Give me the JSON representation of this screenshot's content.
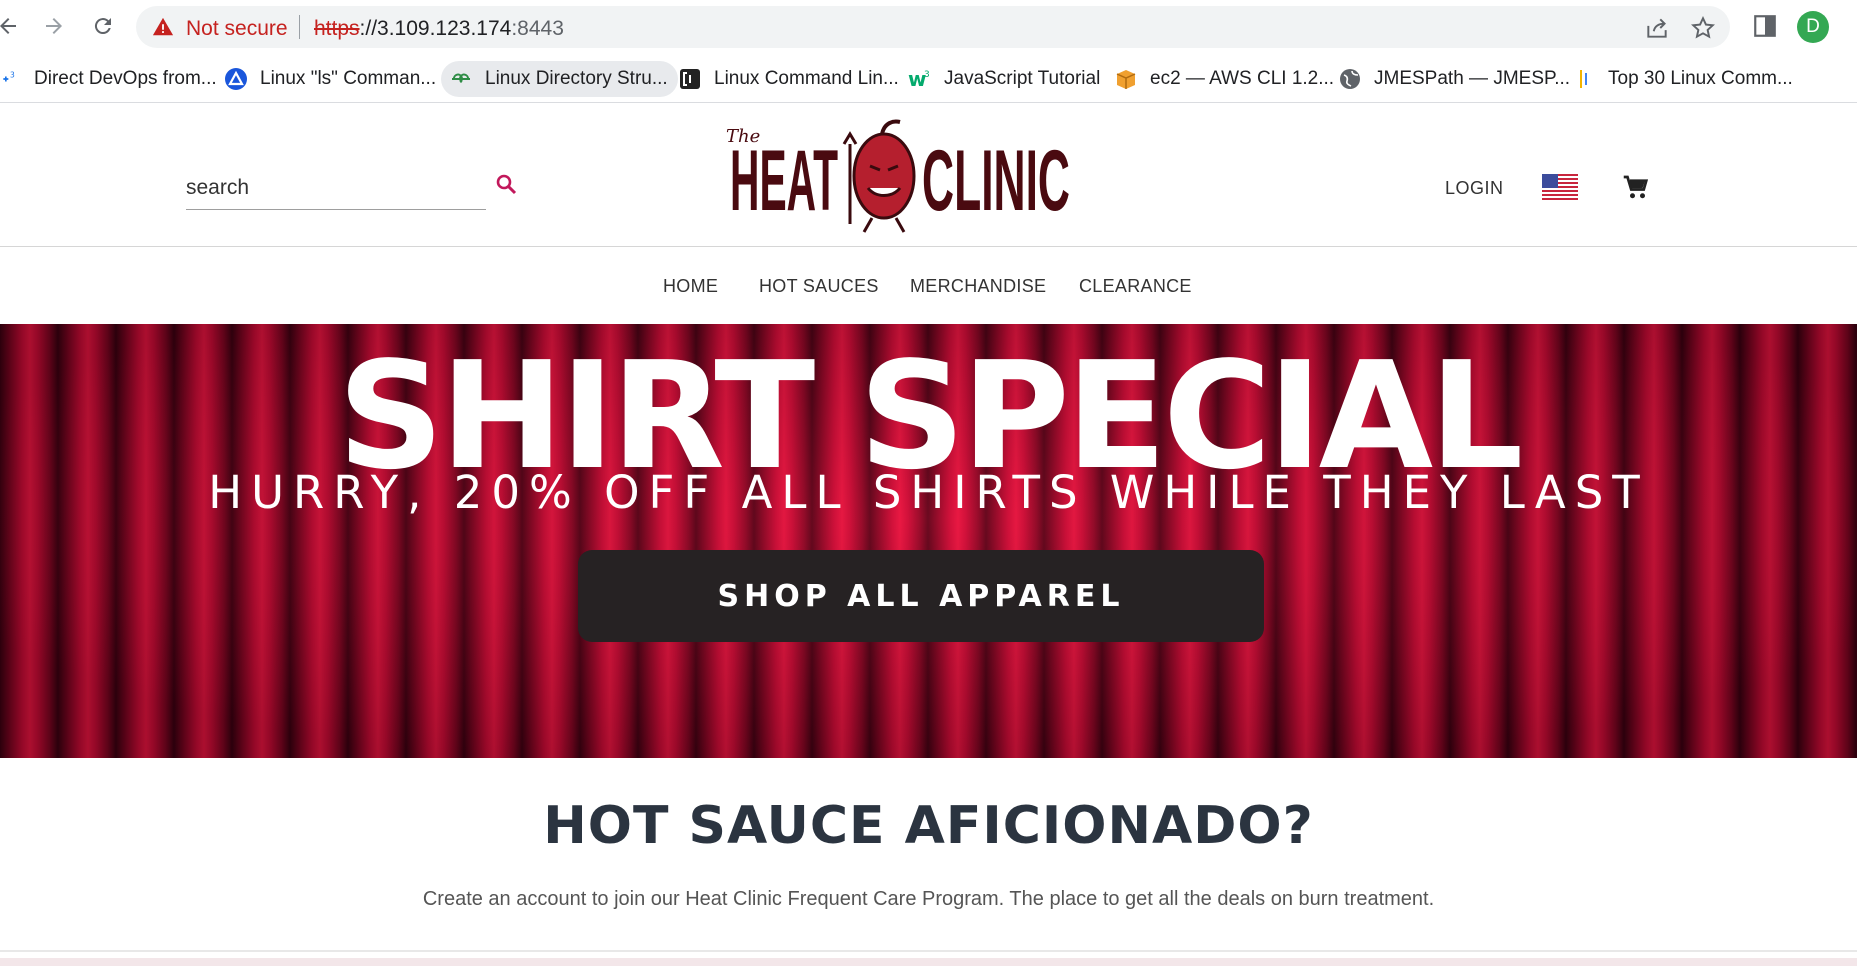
{
  "browser": {
    "security_label": "Not secure",
    "url_scheme": "https",
    "url_rest": "://3.109.123.174",
    "url_port": ":8443",
    "avatar_letter": "D",
    "bookmarks": [
      {
        "label": "Direct DevOps from...",
        "icon": "devops-icon"
      },
      {
        "label": "Linux \"ls\" Comman...",
        "icon": "triangle-logo-icon"
      },
      {
        "label": "Linux Directory Stru...",
        "icon": "geeksforgeeks-icon"
      },
      {
        "label": "Linux Command Lin...",
        "icon": "bracket-logo-icon"
      },
      {
        "label": "JavaScript Tutorial",
        "icon": "w3schools-icon"
      },
      {
        "label": "ec2 — AWS CLI 1.2...",
        "icon": "aws-box-icon"
      },
      {
        "label": "JMESPath — JMESP...",
        "icon": "globe-icon"
      },
      {
        "label": "Top 30 Linux Comm...",
        "icon": "bars-icon"
      }
    ]
  },
  "header": {
    "search_placeholder": "search",
    "logo_text_the": "The",
    "logo_text_heat": "HEAT",
    "logo_text_clinic": "CLINIC",
    "login_label": "LOGIN"
  },
  "nav": {
    "items": [
      "HOME",
      "HOT SAUCES",
      "MERCHANDISE",
      "CLEARANCE"
    ]
  },
  "banner": {
    "title": "SHIRT SPECIAL",
    "subtitle": "HURRY, 20% OFF ALL SHIRTS WHILE THEY LAST",
    "cta_label": "SHOP ALL APPAREL"
  },
  "section": {
    "title": "HOT SAUCE AFICIONADO?",
    "description": "Create an account to join our Heat Clinic Frequent Care Program. The place to get all the deals on burn treatment."
  },
  "colors": {
    "brand_red": "#c40a34",
    "logo_dark": "#4a0a10",
    "search_accent": "#c2185b",
    "warning_red": "#c5221f"
  }
}
